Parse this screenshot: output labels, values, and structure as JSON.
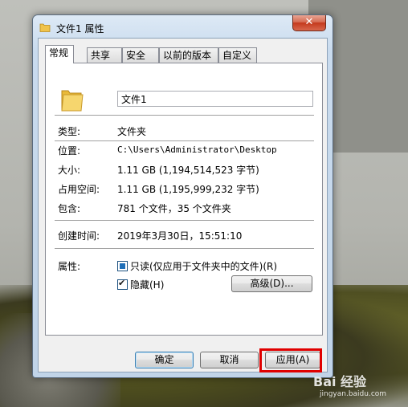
{
  "window": {
    "title": "文件1 属性",
    "close_label": "✕"
  },
  "tabs": [
    {
      "label": "常规",
      "active": true
    },
    {
      "label": "共享"
    },
    {
      "label": "安全"
    },
    {
      "label": "以前的版本"
    },
    {
      "label": "自定义"
    }
  ],
  "general": {
    "name_value": "文件1",
    "type_label": "类型:",
    "type_value": "文件夹",
    "location_label": "位置:",
    "location_value": "C:\\Users\\Administrator\\Desktop",
    "size_label": "大小:",
    "size_value": "1.11 GB (1,194,514,523 字节)",
    "disk_size_label": "占用空间:",
    "disk_size_value": "1.11 GB (1,195,999,232 字节)",
    "contains_label": "包含:",
    "contains_value": "781 个文件，35 个文件夹",
    "created_label": "创建时间:",
    "created_value": "2019年3月30日，15:51:10",
    "attributes_label": "属性:",
    "readonly_label": "只读(仅应用于文件夹中的文件)(R)",
    "readonly_state": "indeterminate",
    "hidden_label": "隐藏(H)",
    "hidden_checked": true,
    "advanced_label": "高级(D)..."
  },
  "footer": {
    "ok_label": "确定",
    "cancel_label": "取消",
    "apply_label": "应用(A)"
  },
  "watermark": {
    "text": "Bai 经验",
    "url": "jingyan.baidu.com"
  },
  "colors": {
    "highlight": "#e00000",
    "close_button": "#c4391d",
    "folder": "#f0c34a"
  }
}
